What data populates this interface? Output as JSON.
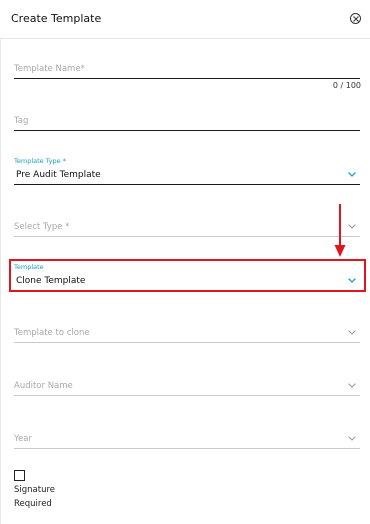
{
  "header": {
    "title": "Create Template",
    "close_icon": "close-circle-icon"
  },
  "fields": {
    "template_name": {
      "placeholder": "Template Name*",
      "value": "",
      "counter": "0 / 100"
    },
    "tag": {
      "placeholder": "Tag",
      "value": ""
    },
    "template_type": {
      "label": "Template Type *",
      "value": "Pre Audit Template"
    },
    "select_type": {
      "placeholder": "Select Type *",
      "value": ""
    },
    "template": {
      "label": "Template",
      "value": "Clone Template"
    },
    "template_to_clone": {
      "placeholder": "Template to clone",
      "value": ""
    },
    "auditor_name": {
      "placeholder": "Auditor Name",
      "value": ""
    },
    "year": {
      "placeholder": "Year",
      "value": ""
    }
  },
  "signature": {
    "label": "Signature Required",
    "checked": false
  },
  "colors": {
    "accent": "#17a2b8",
    "annotation": "#e0151d",
    "chevron_inactive": "#9a9a9a"
  }
}
